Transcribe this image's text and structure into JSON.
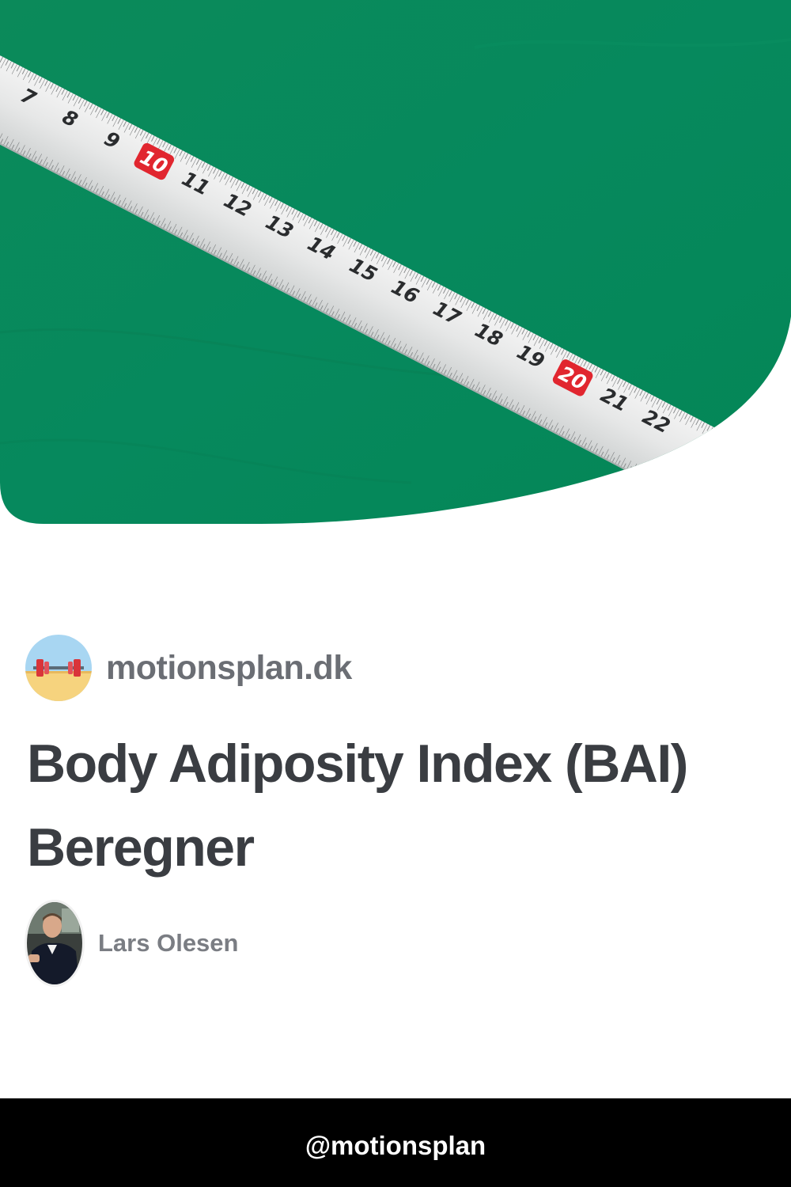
{
  "hero": {
    "image_icon": "measuring-tape-icon",
    "background_color": "#078a5c",
    "tape_color": "#e9eaea",
    "tape_numbers": [
      "7",
      "8",
      "9",
      "10",
      "11",
      "12",
      "13",
      "14",
      "15",
      "16",
      "17",
      "18",
      "19",
      "20",
      "21",
      "22"
    ],
    "highlighted_numbers": [
      "10",
      "20"
    ],
    "highlight_color": "#e1262f"
  },
  "site": {
    "logo_icon": "barbell-logo-icon",
    "name": "motionsplan.dk"
  },
  "article": {
    "title": "Body Adiposity Index (BAI) Beregner"
  },
  "author": {
    "avatar_icon": "author-avatar",
    "name": "Lars Olesen"
  },
  "footer": {
    "handle": "@motionsplan",
    "background_color": "#000000"
  }
}
